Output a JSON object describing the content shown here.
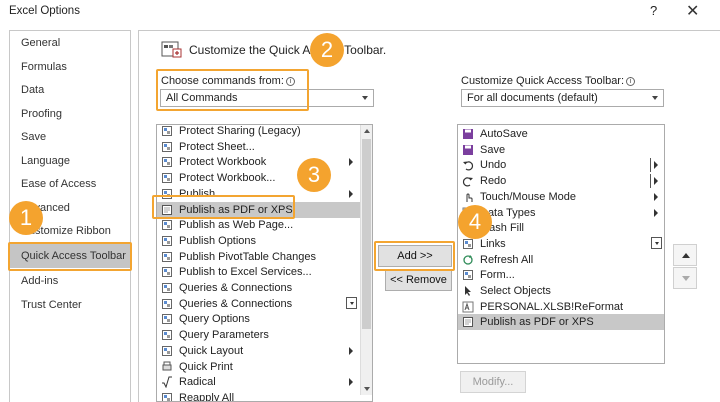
{
  "window": {
    "title": "Excel Options",
    "help": "?",
    "close": "✕"
  },
  "nav": {
    "items": [
      {
        "label": "General",
        "selected": false
      },
      {
        "label": "Formulas",
        "selected": false
      },
      {
        "label": "Data",
        "selected": false
      },
      {
        "label": "Proofing",
        "selected": false
      },
      {
        "label": "Save",
        "selected": false
      },
      {
        "label": "Language",
        "selected": false
      },
      {
        "label": "Ease of Access",
        "selected": false
      },
      {
        "label": "Advanced",
        "selected": false
      },
      {
        "label": "Customize Ribbon",
        "selected": false
      },
      {
        "label": "Quick Access Toolbar",
        "selected": true
      },
      {
        "label": "Add-ins",
        "selected": false
      },
      {
        "label": "Trust Center",
        "selected": false
      }
    ]
  },
  "main": {
    "heading": "Customize the Quick Access Toolbar.",
    "choose_label": "Choose commands from:",
    "choose_value": "All Commands",
    "customize_label": "Customize Quick Access Toolbar:",
    "customize_value": "For all documents (default)",
    "commands": [
      {
        "label": "Protect Sharing (Legacy)",
        "icon": "protect-sharing-icon"
      },
      {
        "label": "Protect Sheet...",
        "icon": "protect-sheet-icon"
      },
      {
        "label": "Protect Workbook",
        "icon": "protect-workbook-icon",
        "submenu": true
      },
      {
        "label": "Protect Workbook...",
        "icon": "protect-workbook-dialog-icon"
      },
      {
        "label": "Publish",
        "icon": "publish-icon",
        "submenu": true
      },
      {
        "label": "Publish as PDF or XPS",
        "icon": "pdf-icon",
        "selected": true
      },
      {
        "label": "Publish as Web Page...",
        "icon": "web-page-icon"
      },
      {
        "label": "Publish Options",
        "icon": "publish-options-icon"
      },
      {
        "label": "Publish PivotTable Changes",
        "icon": "pivot-icon"
      },
      {
        "label": "Publish to Excel Services...",
        "icon": "excel-services-icon"
      },
      {
        "label": "Queries & Connections",
        "icon": "queries-icon"
      },
      {
        "label": "Queries & Connections",
        "icon": "queries-icon",
        "combo": true
      },
      {
        "label": "Query Options",
        "icon": "query-options-icon"
      },
      {
        "label": "Query Parameters",
        "icon": "query-params-icon"
      },
      {
        "label": "Quick Layout",
        "icon": "quick-layout-icon",
        "submenu": true
      },
      {
        "label": "Quick Print",
        "icon": "quick-print-icon"
      },
      {
        "label": "Radical",
        "icon": "radical-icon",
        "submenu": true
      },
      {
        "label": "Reapply All",
        "icon": "reapply-icon"
      }
    ],
    "toolbar_items": [
      {
        "label": "AutoSave",
        "icon": "autosave-icon"
      },
      {
        "label": "Save",
        "icon": "save-icon"
      },
      {
        "label": "Undo",
        "icon": "undo-icon",
        "split": true
      },
      {
        "label": "Redo",
        "icon": "redo-icon",
        "split": true
      },
      {
        "label": "Touch/Mouse Mode",
        "icon": "touch-mode-icon",
        "submenu": true
      },
      {
        "label": "Data Types",
        "icon": "data-types-icon",
        "submenu": true
      },
      {
        "label": "Flash Fill",
        "icon": "flash-fill-icon"
      },
      {
        "label": "Links",
        "icon": "links-icon",
        "combo": true
      },
      {
        "label": "Refresh All",
        "icon": "refresh-icon"
      },
      {
        "label": "Form...",
        "icon": "form-icon"
      },
      {
        "label": "Select Objects",
        "icon": "select-objects-icon"
      },
      {
        "label": "PERSONAL.XLSB!ReFormat",
        "icon": "macro-icon"
      },
      {
        "label": "Publish as PDF or XPS",
        "icon": "pdf-icon",
        "selected": true
      }
    ],
    "add_button": "Add >>",
    "remove_button": "<< Remove",
    "modify_button": "Modify..."
  },
  "callouts": [
    "1",
    "2",
    "3",
    "4"
  ],
  "colors": {
    "highlight": "#f3a531",
    "badge": "#f4a32e",
    "selection": "#c8c8c8"
  }
}
